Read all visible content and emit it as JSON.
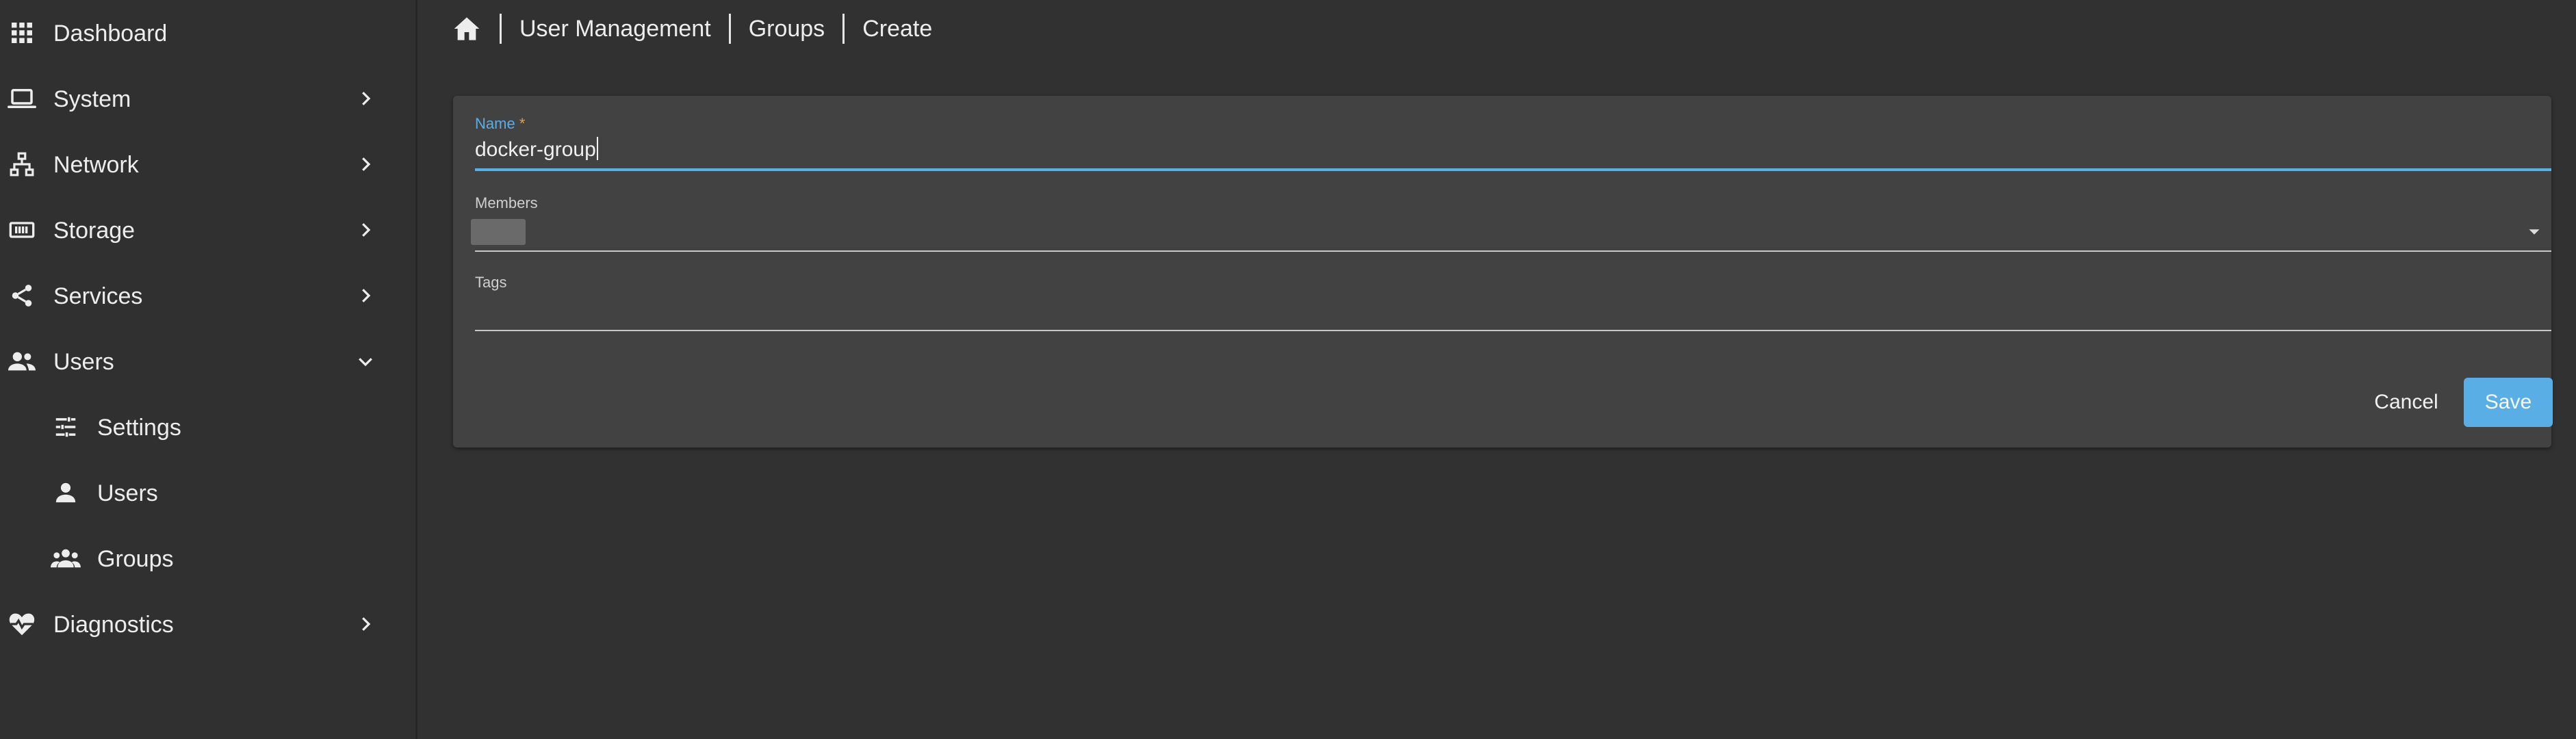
{
  "sidebar": {
    "items": [
      {
        "label": "Dashboard",
        "icon": "apps-grid-icon"
      },
      {
        "label": "System",
        "icon": "laptop-icon"
      },
      {
        "label": "Network",
        "icon": "network-icon"
      },
      {
        "label": "Storage",
        "icon": "storage-icon"
      },
      {
        "label": "Services",
        "icon": "share-icon"
      },
      {
        "label": "Users",
        "icon": "account-group-icon"
      },
      {
        "label": "Settings",
        "icon": "tune-icon"
      },
      {
        "label": "Users",
        "icon": "account-icon"
      },
      {
        "label": "Groups",
        "icon": "account-multiple-icon"
      },
      {
        "label": "Diagnostics",
        "icon": "heart-pulse-icon"
      }
    ]
  },
  "breadcrumb": {
    "home_icon": "home-icon",
    "items": [
      "User Management",
      "Groups",
      "Create"
    ]
  },
  "form": {
    "name_label": "Name",
    "name_required": "*",
    "name_value": "docker-group",
    "members_label": "Members",
    "tags_label": "Tags",
    "cancel_label": "Cancel",
    "save_label": "Save"
  },
  "colors": {
    "accent": "#5aaee6",
    "background": "#313131",
    "card": "#424242",
    "required": "#e1a04a"
  }
}
